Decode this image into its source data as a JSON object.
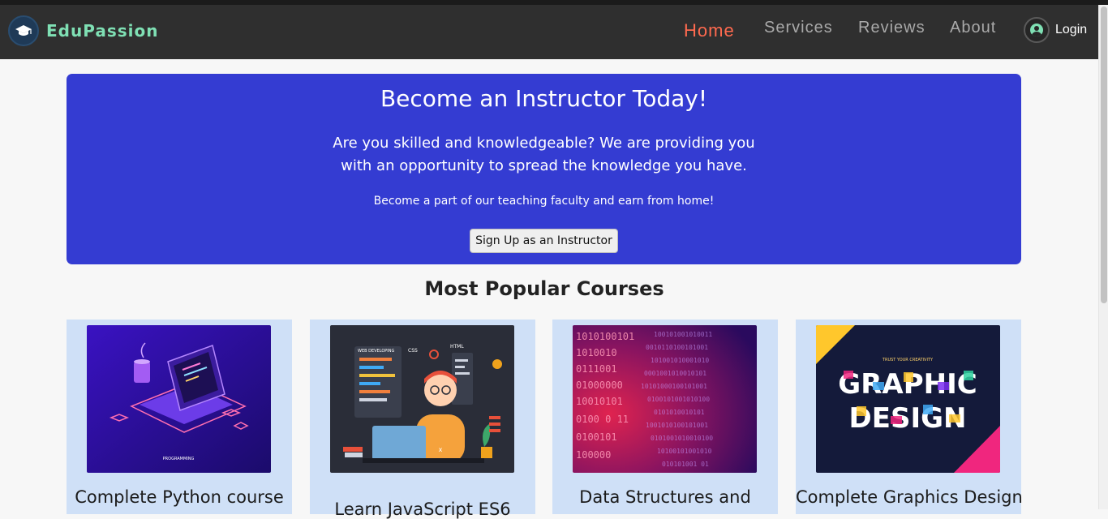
{
  "navbar": {
    "brand": "EduPassion",
    "links": [
      {
        "label": "Home",
        "active": true
      },
      {
        "label": "Services",
        "active": false
      },
      {
        "label": "Reviews",
        "active": false
      },
      {
        "label": "About",
        "active": false
      }
    ],
    "login_label": "Login"
  },
  "hero": {
    "title": "Become an Instructor Today!",
    "description": "Are you skilled and knowledgeable? We are providing you with an opportunity to spread the knowledge you have.",
    "subtext": "Become a part of our teaching faculty and earn from home!",
    "button_label": "Sign Up as an Instructor",
    "background_color": "#343cd2"
  },
  "courses": {
    "section_title": "Most Popular Courses",
    "items": [
      {
        "title": "Complete Python course",
        "image": "python-laptop-illustration",
        "image_caption": "PROGRAMMING"
      },
      {
        "title": "Learn JavaScript ES6",
        "image": "web-developer-illustration",
        "image_labels": [
          "WEB DEVELOPING",
          "CSS",
          "HTML"
        ]
      },
      {
        "title": "Data Structures and",
        "image": "binary-code-background"
      },
      {
        "title": "Complete Graphics Design",
        "image": "graphic-design-typography",
        "image_caption": "TRUST YOUR CREATIVITY",
        "image_text": [
          "GRAPHIC",
          "DESIGN"
        ]
      }
    ]
  },
  "colors": {
    "navbar": "#2f2f2f",
    "brand": "#7fe0b4",
    "active_link": "#ff6a4f",
    "card_background": "#cfe0f7"
  }
}
